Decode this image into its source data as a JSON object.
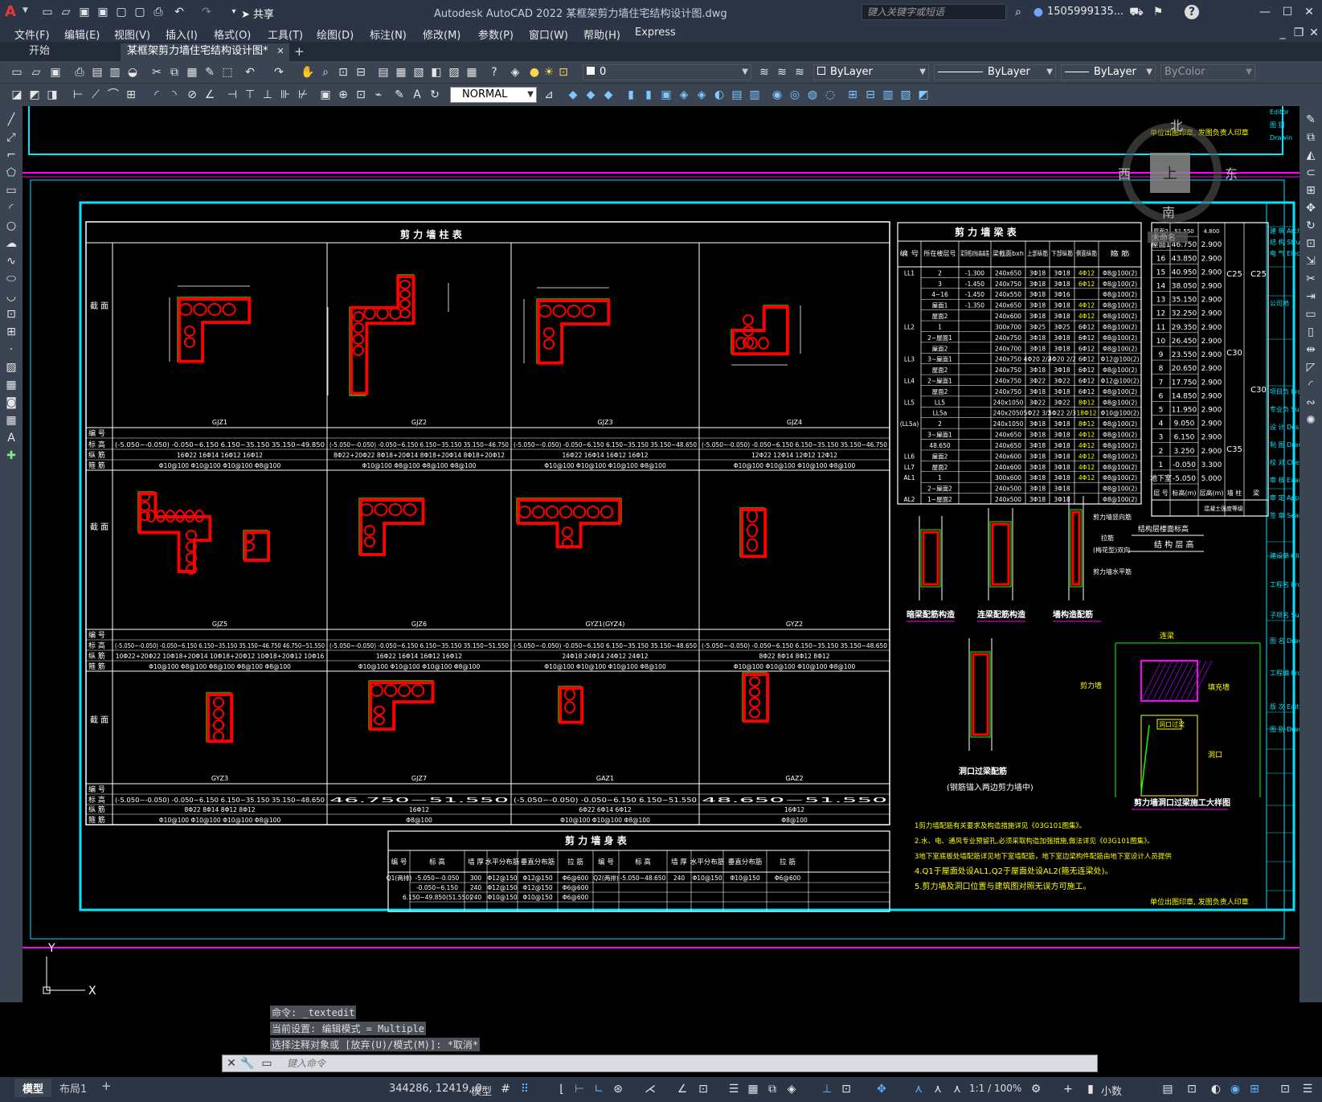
{
  "app": {
    "title": "Autodesk AutoCAD 2022    某框架剪力墙住宅结构设计图.dwg",
    "search_placeholder": "键入关键字或短语",
    "user": "1505999135...",
    "share_label": "共享"
  },
  "menu": [
    "文件(F)",
    "编辑(E)",
    "视图(V)",
    "插入(I)",
    "格式(O)",
    "工具(T)",
    "绘图(D)",
    "标注(N)",
    "修改(M)",
    "参数(P)",
    "窗口(W)",
    "帮助(H)",
    "Express"
  ],
  "tabs": {
    "start": "开始",
    "active": "某框架剪力墙住宅结构设计图*",
    "add": "+"
  },
  "toolbar": {
    "layer": "0",
    "color": "ByLayer",
    "linetype": "ByLayer",
    "lineweight": "ByLayer",
    "plotstyle": "ByColor",
    "textstyle": "NORMAL"
  },
  "viewcube": {
    "north": "北",
    "south": "南",
    "east": "东",
    "west": "西",
    "top": "上",
    "wcs": "未命名"
  },
  "drawing": {
    "col_table_title": "剪 力 墙 柱 表",
    "beam_table_title": "剪 力 墙 梁 表",
    "body_table_title": "剪 力 墙 身 表",
    "row_labels": [
      "截 面",
      "编 号",
      "标 高",
      "纵 筋",
      "箍 筋"
    ],
    "row1": [
      {
        "id": "GJZ1",
        "elev": "(-5.050~-0.050)  -0.050~6.150  6.150~35.150  35.150~49.850",
        "long": "16Φ22     16Φ14     16Φ12     16Φ12",
        "stir": "Φ10@100   Φ10@100   Φ10@100   Φ8@100"
      },
      {
        "id": "GJZ2",
        "elev": "(-5.050~-0.050)  -0.050~6.150  6.150~35.150  35.150~46.750",
        "long": "8Φ22+20Φ22  8Φ18+20Φ14  8Φ18+20Φ14  8Φ18+20Φ12",
        "stir": "Φ10@100   Φ8@100   Φ8@100   Φ8@100"
      },
      {
        "id": "GJZ3",
        "elev": "(-5.050~-0.050)  -0.050~6.150  6.150~35.150  35.150~48.650",
        "long": "16Φ22     16Φ14     16Φ12     16Φ12",
        "stir": "Φ10@100   Φ10@100   Φ10@100   Φ8@100"
      },
      {
        "id": "GJZ4",
        "elev": "(-5.050~-0.050)  -0.050~6.150  6.150~35.150  35.150~46.750",
        "long": "12Φ22     12Φ14     12Φ12     12Φ12",
        "stir": "Φ10@100   Φ10@100   Φ10@100   Φ8@100"
      }
    ],
    "row2": [
      {
        "id": "GJZ5",
        "elev": "(-5.050~-0.050) -0.050~6.150  6.150~35.150  35.150~46.750  46.750~51.550",
        "long": "10Φ22+20Φ22  10Φ18+20Φ14  10Φ18+20Φ12  10Φ18+20Φ12  10Φ16",
        "stir": "Φ10@100   Φ8@100   Φ8@100   Φ8@100   Φ8@100"
      },
      {
        "id": "GJZ6",
        "elev": "(-5.050~-0.050)  -0.050~6.150  6.150~35.150  35.150~51.550",
        "long": "16Φ22     16Φ14     16Φ12     16Φ12",
        "stir": "Φ10@100   Φ10@100   Φ10@100   Φ8@100"
      },
      {
        "id": "GYZ1(GYZ4)",
        "elev": "(-5.050~-0.050)  -0.050~6.150  6.150~35.150  35.150~48.650",
        "long": "24Φ18     24Φ14     24Φ12     24Φ12",
        "stir": "Φ10@100   Φ10@100   Φ10@100   Φ8@100"
      },
      {
        "id": "GYZ2",
        "elev": "(-5.050~-0.050)  -0.050~6.150  6.150~35.150  35.150~48.650",
        "long": "8Φ22     8Φ14     8Φ12     8Φ12",
        "stir": "Φ10@100   Φ10@100   Φ10@100   Φ8@100"
      }
    ],
    "row3": [
      {
        "id": "GYZ3",
        "elev": "(-5.050~-0.050)  -0.050~6.150  6.150~35.150  35.150~48.650",
        "long": "8Φ22     8Φ14     8Φ12     8Φ12",
        "stir": "Φ10@100   Φ10@100   Φ10@100   Φ8@100"
      },
      {
        "id": "GJZ7",
        "elev": "46.750~51.550",
        "long": "16Φ12",
        "stir": "Φ8@100"
      },
      {
        "id": "GAZ1",
        "elev": "(-5.050~-0.050)    -0.050~6.150    6.150~51.550",
        "long": "6Φ22     6Φ14     6Φ12",
        "stir": "Φ10@100   Φ10@100   Φ8@100"
      },
      {
        "id": "GAZ2",
        "elev": "48.650~51.550",
        "long": "16Φ12",
        "stir": "Φ8@100"
      }
    ],
    "beam_headers": [
      "编 号",
      "所在楼层号",
      "梁顶相对标高高差",
      "梁截面bxh",
      "上部纵筋",
      "下部纵筋",
      "侧面纵筋",
      "箍 筋"
    ],
    "beam_rows": [
      [
        "LL1",
        "2",
        "-1.300",
        "240x650",
        "3Φ18",
        "3Φ18",
        "4Φ12",
        "Φ8@100(2)"
      ],
      [
        "",
        "3",
        "-1.450",
        "240x750",
        "3Φ18",
        "3Φ18",
        "6Φ12",
        "Φ8@100(2)"
      ],
      [
        "",
        "4~16",
        "-1.450",
        "240x550",
        "3Φ18",
        "3Φ16",
        "",
        "Φ8@100(2)"
      ],
      [
        "",
        "屋面1",
        "-1.350",
        "240x650",
        "3Φ18",
        "3Φ18",
        "4Φ12",
        "Φ8@100(2)"
      ],
      [
        "",
        "屋面2",
        "",
        "240x600",
        "3Φ18",
        "3Φ18",
        "4Φ12",
        "Φ8@100(2)"
      ],
      [
        "LL2",
        "1",
        "",
        "300x700",
        "3Φ25",
        "3Φ25",
        "6Φ12",
        "Φ8@100(2)"
      ],
      [
        "",
        "2~屋面1",
        "",
        "240x750",
        "3Φ18",
        "3Φ18",
        "6Φ12",
        "Φ8@100(2)"
      ],
      [
        "",
        "屋面2",
        "",
        "240x700",
        "3Φ18",
        "3Φ18",
        "6Φ12",
        "Φ8@100(2)"
      ],
      [
        "LL3",
        "3~屋面1",
        "",
        "240x750",
        "4Φ20 2/2",
        "4Φ20 2/2",
        "6Φ12",
        "Φ12@100(2)"
      ],
      [
        "",
        "屋面2",
        "",
        "240x750",
        "3Φ18",
        "3Φ18",
        "6Φ12",
        "Φ8@100(2)"
      ],
      [
        "LL4",
        "2~屋面1",
        "",
        "240x750",
        "3Φ22",
        "3Φ22",
        "6Φ12",
        "Φ12@100(2)"
      ],
      [
        "",
        "屋面2",
        "",
        "240x750",
        "3Φ18",
        "3Φ18",
        "6Φ12",
        "Φ8@100(2)"
      ],
      [
        "LL5",
        "LL5",
        "",
        "240x1050",
        "3Φ22",
        "3Φ22",
        "8Φ12",
        "Φ8@100(2)"
      ],
      [
        "",
        "LL5a",
        "",
        "240x2050",
        "5Φ22 3/2",
        "5Φ22 2/3",
        "18Φ12",
        "Φ10@100(2)"
      ],
      [
        "(LL5a)",
        "2",
        "",
        "240x1050",
        "3Φ18",
        "3Φ18",
        "8Φ12",
        "Φ8@100(2)"
      ],
      [
        "",
        "3~屋面1",
        "",
        "240x650",
        "3Φ18",
        "3Φ18",
        "4Φ12",
        "Φ8@100(2)"
      ],
      [
        "",
        "48.650",
        "",
        "240x650",
        "3Φ18",
        "3Φ18",
        "4Φ12",
        "Φ8@100(2)"
      ],
      [
        "LL6",
        "屋面2",
        "",
        "240x600",
        "3Φ18",
        "3Φ18",
        "4Φ12",
        "Φ8@100(2)"
      ],
      [
        "LL7",
        "屋面2",
        "",
        "240x600",
        "3Φ18",
        "3Φ18",
        "4Φ12",
        "Φ8@100(2)"
      ],
      [
        "AL1",
        "1",
        "",
        "300x600",
        "3Φ18",
        "3Φ18",
        "4Φ12",
        "Φ8@100(2)"
      ],
      [
        "",
        "2~屋面2",
        "",
        "240x500",
        "3Φ18",
        "3Φ18",
        "",
        "Φ8@100(2)"
      ],
      [
        "AL2",
        "1~屋面2",
        "",
        "240x500",
        "3Φ18",
        "3Φ18",
        "",
        "Φ8@100(2)"
      ]
    ],
    "floor_rows": [
      [
        "屋面2",
        "51.550",
        "4.800"
      ],
      [
        "屋面1",
        "46.750",
        "2.900"
      ],
      [
        "16",
        "43.850",
        "2.900"
      ],
      [
        "15",
        "40.950",
        "2.900"
      ],
      [
        "14",
        "38.050",
        "2.900"
      ],
      [
        "13",
        "35.150",
        "2.900"
      ],
      [
        "12",
        "32.250",
        "2.900"
      ],
      [
        "11",
        "29.350",
        "2.900"
      ],
      [
        "10",
        "26.450",
        "2.900"
      ],
      [
        "9",
        "23.550",
        "2.900"
      ],
      [
        "8",
        "20.650",
        "2.900"
      ],
      [
        "7",
        "17.750",
        "2.900"
      ],
      [
        "6",
        "14.850",
        "2.900"
      ],
      [
        "5",
        "11.950",
        "2.900"
      ],
      [
        "4",
        "9.050",
        "2.900"
      ],
      [
        "3",
        "6.150",
        "2.900"
      ],
      [
        "2",
        "3.250",
        "2.900"
      ],
      [
        "1",
        "-0.050",
        "3.300"
      ],
      [
        "地下室",
        "-5.050",
        "5.000"
      ]
    ],
    "floor_footer": [
      "层 号",
      "标高(m)",
      "层高(m)",
      "墙 柱",
      "梁"
    ],
    "concrete": [
      "C25",
      "C25",
      "C30",
      "C30",
      "C35"
    ],
    "floor_title1": "结构层楼面标高",
    "floor_title2": "结 构 层 高",
    "floor_note": "混凝土强度等级",
    "detail_labels": [
      "暗梁配筋构造",
      "连梁配筋构造",
      "墙构造配筋",
      "洞口过梁配筋",
      "(钢筋锚入两边剪力墙中)",
      "剪力墙洞口过梁施工大样图"
    ],
    "detail_small": [
      "剪力墙竖向筋",
      "拉筋",
      "(梅花型)双向",
      "剪力墙水平筋",
      "连梁",
      "填充墙",
      "剪力墙",
      "洞口过梁",
      "洞口"
    ],
    "notes": [
      "1剪力墙配筋有关要求及构造措施详见《03G101图集》。",
      "2.水、电、通风专业预留孔,必须采取构造加强措施,做法详见《03G101图集》。",
      "3地下室底板处墙配筋详见地下室墙配筋，地下室边梁构件配筋由地下室设计人员提供",
      "4.Q1于屋面处设AL1,Q2于屋面处设AL2(箍无连梁处)。",
      "5.剪力墙及洞口位置与建筑图对照无误方可施工。"
    ],
    "body_headers": [
      "编 号",
      "标 高",
      "墙 厚",
      "水平分布筋",
      "垂直分布筋",
      "拉 筋",
      "编 号",
      "标 高",
      "墙 厚",
      "水平分布筋",
      "垂直分布筋",
      "拉 筋"
    ],
    "body_rows": [
      [
        "Q1(两排)",
        "-5.050~-0.050",
        "300",
        "Φ12@150",
        "Φ12@150",
        "Φ6@600",
        "Q2(两排)",
        "-5.050~48.650",
        "240",
        "Φ10@150",
        "Φ10@150",
        "Φ6@600"
      ],
      [
        "",
        "-0.050~6.150",
        "240",
        "Φ12@150",
        "Φ12@150",
        "Φ6@600",
        "",
        "",
        "",
        "",
        "",
        ""
      ],
      [
        "",
        "6.150~49.850(51.550)",
        "240",
        "Φ10@150",
        "Φ10@150",
        "Φ6@600",
        "",
        "",
        "",
        "",
        "",
        ""
      ]
    ],
    "stamp_top": "单位出图印章, 发图负责人印章",
    "stamp_bottom": "单位出图印章, 发图负责人印章",
    "titleblock": [
      "Editor",
      "图 别",
      "Drawin",
      "建 筑 Archite",
      "结 构 Structu",
      "电 气 Electri",
      "公司地",
      "项目负 Project",
      "专业负 Sub Ch",
      "设 计 Designe",
      "制 图 Drawn b",
      "校 对 Checke",
      "审 核 Examin",
      "审 定 Approv",
      "签 章 Seal",
      "建设单 Client",
      "工程名 Projec",
      "子项名 Sub-Pr",
      "图 名 Drawin Title",
      "工程编 Projec",
      "版 次 Editor",
      "图 别 Drawin"
    ]
  },
  "command": {
    "history": [
      "命令: _textedit",
      "当前设置: 编辑模式 = Multiple",
      "选择注释对象或 [放弃(U)/模式(M)]: *取消*"
    ],
    "placeholder": "键入命令"
  },
  "ucs": {
    "x": "X",
    "y": "Y"
  },
  "layouts": [
    "模型",
    "布局1",
    "+"
  ],
  "status": {
    "coords": "344286, 12419, 0",
    "model": "模型",
    "scale": "1:1 / 100%",
    "units": "小数"
  }
}
